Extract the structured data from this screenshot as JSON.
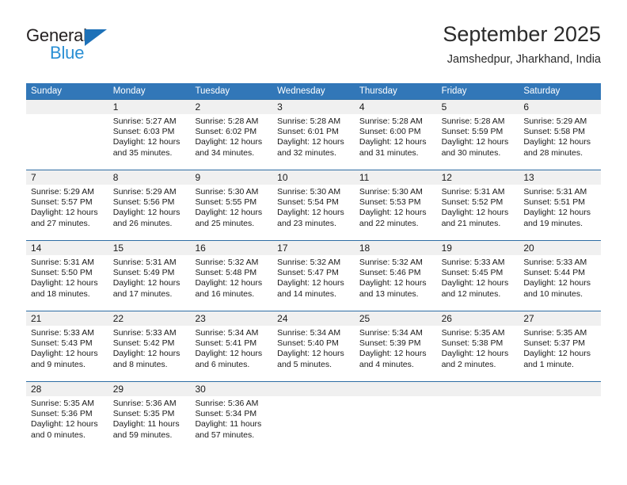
{
  "brand": {
    "name_part1": "General",
    "name_part2": "Blue"
  },
  "header": {
    "title": "September 2025",
    "subtitle": "Jamshedpur, Jharkhand, India"
  },
  "calendar": {
    "weekdays": [
      "Sunday",
      "Monday",
      "Tuesday",
      "Wednesday",
      "Thursday",
      "Friday",
      "Saturday"
    ],
    "accent_color": "#3277b8",
    "rule_color": "#2e6da4",
    "day_band_color": "#f0f0f0",
    "weeks": [
      [
        {
          "day": "",
          "sunrise": "",
          "sunset": "",
          "daylight1": "",
          "daylight2": ""
        },
        {
          "day": "1",
          "sunrise": "Sunrise: 5:27 AM",
          "sunset": "Sunset: 6:03 PM",
          "daylight1": "Daylight: 12 hours",
          "daylight2": "and 35 minutes."
        },
        {
          "day": "2",
          "sunrise": "Sunrise: 5:28 AM",
          "sunset": "Sunset: 6:02 PM",
          "daylight1": "Daylight: 12 hours",
          "daylight2": "and 34 minutes."
        },
        {
          "day": "3",
          "sunrise": "Sunrise: 5:28 AM",
          "sunset": "Sunset: 6:01 PM",
          "daylight1": "Daylight: 12 hours",
          "daylight2": "and 32 minutes."
        },
        {
          "day": "4",
          "sunrise": "Sunrise: 5:28 AM",
          "sunset": "Sunset: 6:00 PM",
          "daylight1": "Daylight: 12 hours",
          "daylight2": "and 31 minutes."
        },
        {
          "day": "5",
          "sunrise": "Sunrise: 5:28 AM",
          "sunset": "Sunset: 5:59 PM",
          "daylight1": "Daylight: 12 hours",
          "daylight2": "and 30 minutes."
        },
        {
          "day": "6",
          "sunrise": "Sunrise: 5:29 AM",
          "sunset": "Sunset: 5:58 PM",
          "daylight1": "Daylight: 12 hours",
          "daylight2": "and 28 minutes."
        }
      ],
      [
        {
          "day": "7",
          "sunrise": "Sunrise: 5:29 AM",
          "sunset": "Sunset: 5:57 PM",
          "daylight1": "Daylight: 12 hours",
          "daylight2": "and 27 minutes."
        },
        {
          "day": "8",
          "sunrise": "Sunrise: 5:29 AM",
          "sunset": "Sunset: 5:56 PM",
          "daylight1": "Daylight: 12 hours",
          "daylight2": "and 26 minutes."
        },
        {
          "day": "9",
          "sunrise": "Sunrise: 5:30 AM",
          "sunset": "Sunset: 5:55 PM",
          "daylight1": "Daylight: 12 hours",
          "daylight2": "and 25 minutes."
        },
        {
          "day": "10",
          "sunrise": "Sunrise: 5:30 AM",
          "sunset": "Sunset: 5:54 PM",
          "daylight1": "Daylight: 12 hours",
          "daylight2": "and 23 minutes."
        },
        {
          "day": "11",
          "sunrise": "Sunrise: 5:30 AM",
          "sunset": "Sunset: 5:53 PM",
          "daylight1": "Daylight: 12 hours",
          "daylight2": "and 22 minutes."
        },
        {
          "day": "12",
          "sunrise": "Sunrise: 5:31 AM",
          "sunset": "Sunset: 5:52 PM",
          "daylight1": "Daylight: 12 hours",
          "daylight2": "and 21 minutes."
        },
        {
          "day": "13",
          "sunrise": "Sunrise: 5:31 AM",
          "sunset": "Sunset: 5:51 PM",
          "daylight1": "Daylight: 12 hours",
          "daylight2": "and 19 minutes."
        }
      ],
      [
        {
          "day": "14",
          "sunrise": "Sunrise: 5:31 AM",
          "sunset": "Sunset: 5:50 PM",
          "daylight1": "Daylight: 12 hours",
          "daylight2": "and 18 minutes."
        },
        {
          "day": "15",
          "sunrise": "Sunrise: 5:31 AM",
          "sunset": "Sunset: 5:49 PM",
          "daylight1": "Daylight: 12 hours",
          "daylight2": "and 17 minutes."
        },
        {
          "day": "16",
          "sunrise": "Sunrise: 5:32 AM",
          "sunset": "Sunset: 5:48 PM",
          "daylight1": "Daylight: 12 hours",
          "daylight2": "and 16 minutes."
        },
        {
          "day": "17",
          "sunrise": "Sunrise: 5:32 AM",
          "sunset": "Sunset: 5:47 PM",
          "daylight1": "Daylight: 12 hours",
          "daylight2": "and 14 minutes."
        },
        {
          "day": "18",
          "sunrise": "Sunrise: 5:32 AM",
          "sunset": "Sunset: 5:46 PM",
          "daylight1": "Daylight: 12 hours",
          "daylight2": "and 13 minutes."
        },
        {
          "day": "19",
          "sunrise": "Sunrise: 5:33 AM",
          "sunset": "Sunset: 5:45 PM",
          "daylight1": "Daylight: 12 hours",
          "daylight2": "and 12 minutes."
        },
        {
          "day": "20",
          "sunrise": "Sunrise: 5:33 AM",
          "sunset": "Sunset: 5:44 PM",
          "daylight1": "Daylight: 12 hours",
          "daylight2": "and 10 minutes."
        }
      ],
      [
        {
          "day": "21",
          "sunrise": "Sunrise: 5:33 AM",
          "sunset": "Sunset: 5:43 PM",
          "daylight1": "Daylight: 12 hours",
          "daylight2": "and 9 minutes."
        },
        {
          "day": "22",
          "sunrise": "Sunrise: 5:33 AM",
          "sunset": "Sunset: 5:42 PM",
          "daylight1": "Daylight: 12 hours",
          "daylight2": "and 8 minutes."
        },
        {
          "day": "23",
          "sunrise": "Sunrise: 5:34 AM",
          "sunset": "Sunset: 5:41 PM",
          "daylight1": "Daylight: 12 hours",
          "daylight2": "and 6 minutes."
        },
        {
          "day": "24",
          "sunrise": "Sunrise: 5:34 AM",
          "sunset": "Sunset: 5:40 PM",
          "daylight1": "Daylight: 12 hours",
          "daylight2": "and 5 minutes."
        },
        {
          "day": "25",
          "sunrise": "Sunrise: 5:34 AM",
          "sunset": "Sunset: 5:39 PM",
          "daylight1": "Daylight: 12 hours",
          "daylight2": "and 4 minutes."
        },
        {
          "day": "26",
          "sunrise": "Sunrise: 5:35 AM",
          "sunset": "Sunset: 5:38 PM",
          "daylight1": "Daylight: 12 hours",
          "daylight2": "and 2 minutes."
        },
        {
          "day": "27",
          "sunrise": "Sunrise: 5:35 AM",
          "sunset": "Sunset: 5:37 PM",
          "daylight1": "Daylight: 12 hours",
          "daylight2": "and 1 minute."
        }
      ],
      [
        {
          "day": "28",
          "sunrise": "Sunrise: 5:35 AM",
          "sunset": "Sunset: 5:36 PM",
          "daylight1": "Daylight: 12 hours",
          "daylight2": "and 0 minutes."
        },
        {
          "day": "29",
          "sunrise": "Sunrise: 5:36 AM",
          "sunset": "Sunset: 5:35 PM",
          "daylight1": "Daylight: 11 hours",
          "daylight2": "and 59 minutes."
        },
        {
          "day": "30",
          "sunrise": "Sunrise: 5:36 AM",
          "sunset": "Sunset: 5:34 PM",
          "daylight1": "Daylight: 11 hours",
          "daylight2": "and 57 minutes."
        },
        {
          "day": "",
          "sunrise": "",
          "sunset": "",
          "daylight1": "",
          "daylight2": ""
        },
        {
          "day": "",
          "sunrise": "",
          "sunset": "",
          "daylight1": "",
          "daylight2": ""
        },
        {
          "day": "",
          "sunrise": "",
          "sunset": "",
          "daylight1": "",
          "daylight2": ""
        },
        {
          "day": "",
          "sunrise": "",
          "sunset": "",
          "daylight1": "",
          "daylight2": ""
        }
      ]
    ]
  }
}
